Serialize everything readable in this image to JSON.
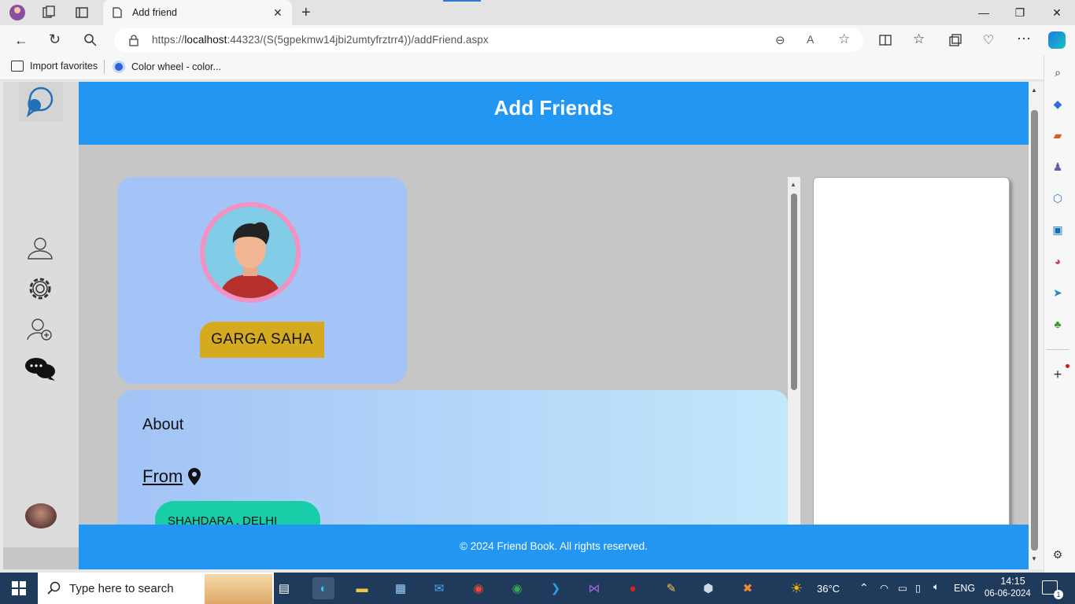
{
  "browser": {
    "tab_title": "Add friend",
    "url_prefix": "https://",
    "url_host": "localhost",
    "url_rest": ":44323/(S(5gpekmw14jbi2umtyfrztrr4))/addFriend.aspx",
    "favorites": [
      {
        "label": "Import favorites",
        "icon": "import-icon"
      },
      {
        "label": "Color wheel - color...",
        "icon": "color-wheel-icon"
      }
    ]
  },
  "page": {
    "header_title": "Add Friends",
    "profile_name": "GARGA  SAHA",
    "about_label": "About",
    "from_label": "From",
    "location": "SHAHDARA , DELHI",
    "footer": "© 2024 Friend Book. All rights reserved."
  },
  "sidebar": {
    "items": [
      {
        "name": "profile-icon"
      },
      {
        "name": "settings-icon"
      },
      {
        "name": "add-friend-icon"
      },
      {
        "name": "chat-icon"
      }
    ]
  },
  "taskbar": {
    "search_placeholder": "Type here to search",
    "weather": "36°C",
    "language": "ENG",
    "time": "14:15",
    "date": "06-06-2024",
    "notification_count": "1"
  },
  "colors": {
    "header_blue": "#2196f3",
    "card_blue": "#a4c4f7",
    "name_badge": "#d6aa1e",
    "location_badge": "#17cea9"
  }
}
